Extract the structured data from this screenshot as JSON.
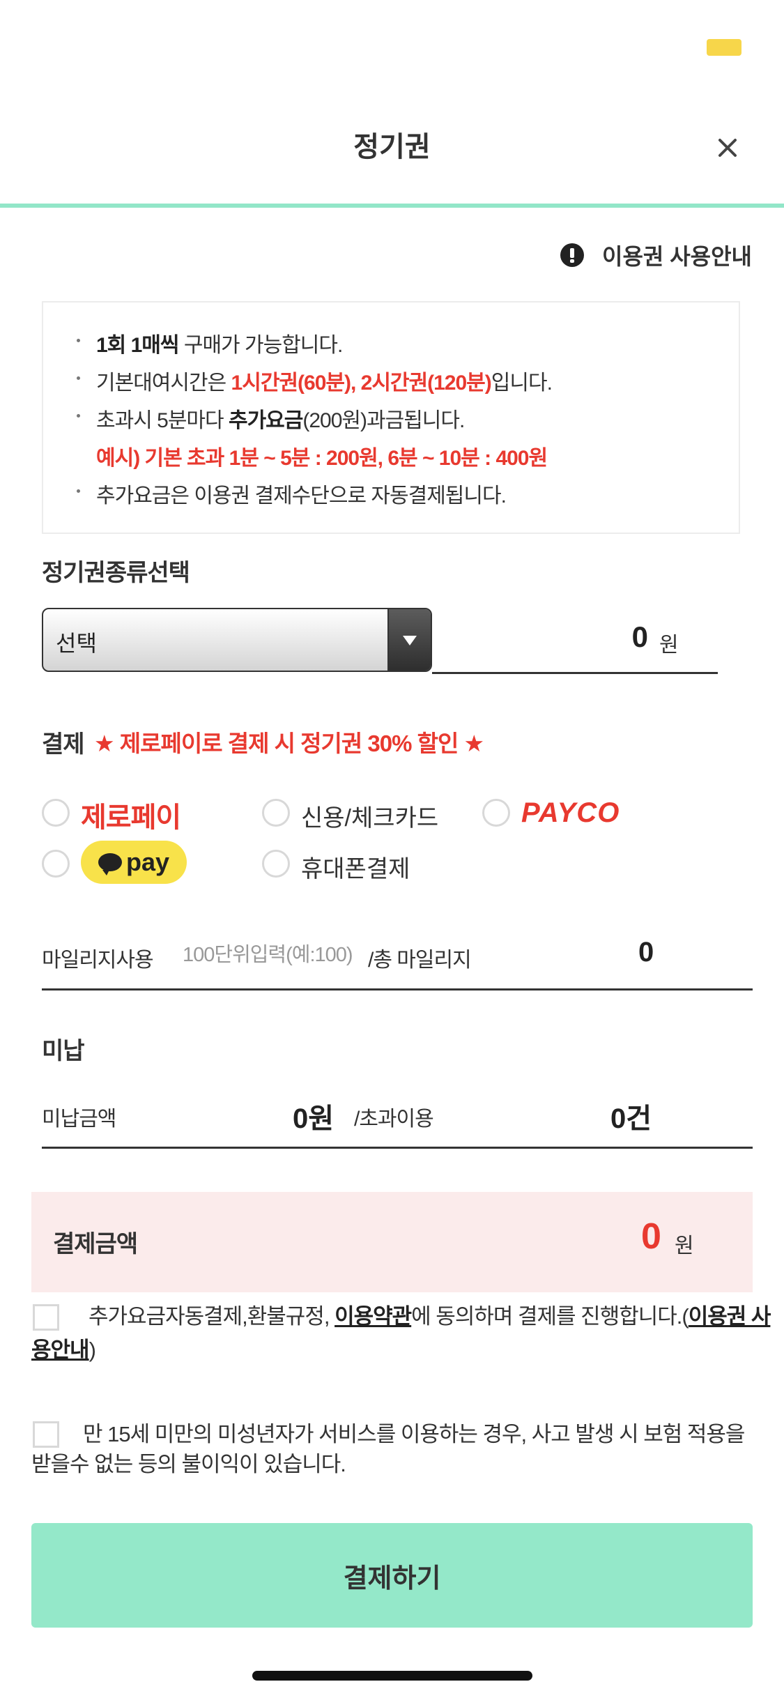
{
  "header": {
    "title": "정기권",
    "close_icon": "close-icon"
  },
  "guide": {
    "icon": "info-icon",
    "label": "이용권 사용안내"
  },
  "info": {
    "line1": {
      "bold": "1회 1매씩",
      "rest": " 구매가 가능합니다."
    },
    "line2": {
      "pre": "기본대여시간은 ",
      "red": "1시간권(60분), 2시간권(120분)",
      "post": "입니다."
    },
    "line3": {
      "pre": "초과시 5분마다 ",
      "bold": "추가요금",
      "post": "(200원)과금됩니다."
    },
    "line3_example": "예시) 기본 초과 1분 ~ 5분 : 200원, 6분 ~ 10분 : 400원",
    "line4": "추가요금은 이용권 결제수단으로 자동결제됩니다."
  },
  "pass_type": {
    "label": "정기권종류선택",
    "select_value": "선택",
    "price": "0",
    "price_unit": "원"
  },
  "payment": {
    "label": "결제",
    "promo": "★ 제로페이로 결제 시 정기권 30% 할인 ★",
    "methods": {
      "zeropay": "제로페이",
      "card": "신용/체크카드",
      "payco": "PAYCO",
      "kakaopay": "pay",
      "phone": "휴대폰결제"
    }
  },
  "mileage": {
    "label": "마일리지사용",
    "placeholder": "100단위입력(예:100)",
    "total_label": "/총 마일리지",
    "total_value": "0"
  },
  "unpaid": {
    "title": "미납",
    "amount_label": "미납금액",
    "amount_value": "0원",
    "over_label": "/초과이용",
    "over_value": "0건"
  },
  "total": {
    "label": "결제금액",
    "value": "0",
    "unit": "원"
  },
  "agreements": {
    "terms_pre": "추가요금자동결제,환불규정, ",
    "terms_link": "이용약관",
    "terms_mid": "에 동의하며 결제를 진행합니다.(",
    "terms_guide_link": "이용권 사용안내",
    "terms_post": ")",
    "minor": "만 15세 미만의 미성년자가 서비스를 이용하는 경우, 사고 발생 시 보험 적용을 받을수 없는 등의 불이익이 있습니다."
  },
  "submit": {
    "label": "결제하기"
  },
  "colors": {
    "accent": "#94e8c9",
    "red": "#e8392f",
    "total_bg": "#fbebeb",
    "kakao": "#f8e24a"
  }
}
